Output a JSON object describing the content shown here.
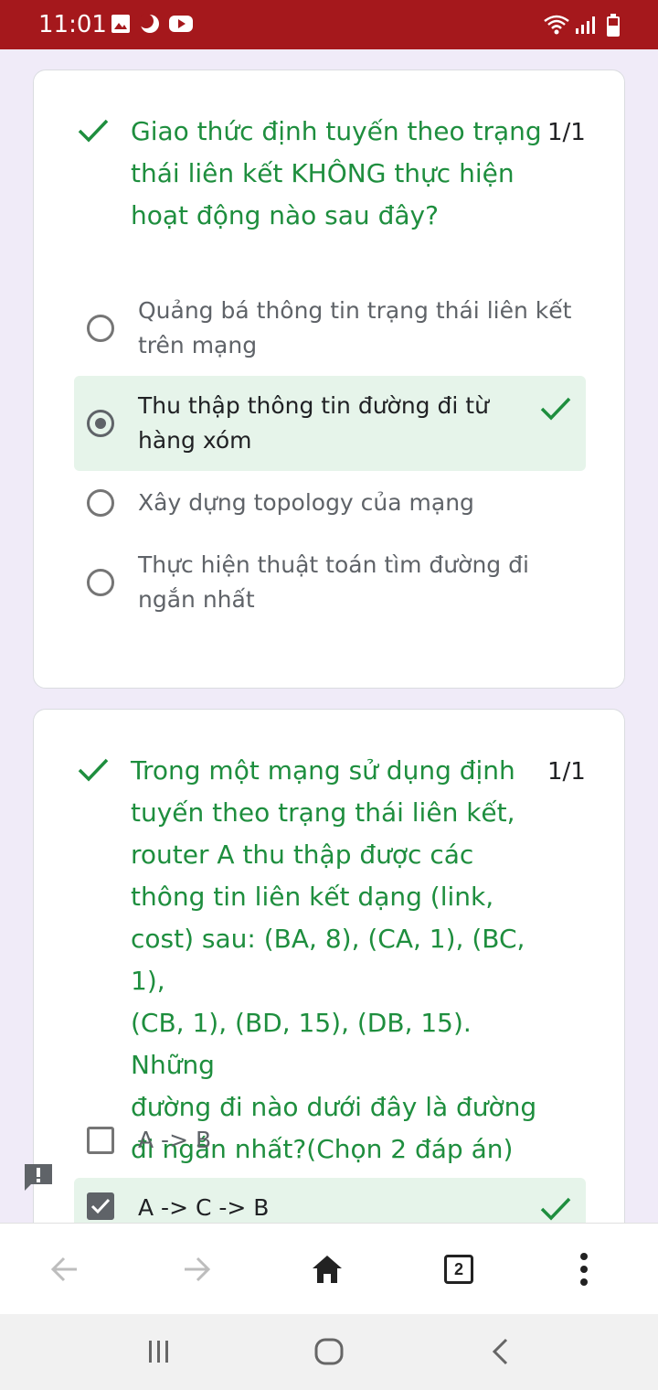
{
  "status_bar": {
    "time": "11:01",
    "icons": [
      "image-icon",
      "moon-icon",
      "youtube-icon",
      "wifi-icon",
      "signal-icon",
      "battery-icon"
    ]
  },
  "questions": [
    {
      "text_lines": [
        "Giao thức định tuyến theo trạng",
        "thái liên kết KHÔNG thực hiện",
        "hoạt động nào sau đây?"
      ],
      "score": "1/1",
      "options": [
        {
          "lines": [
            "Quảng bá thông tin trạng thái liên kết",
            "trên mạng"
          ],
          "selected": false,
          "correct": false
        },
        {
          "lines": [
            "Thu thập thông tin đường đi từ",
            "hàng xóm"
          ],
          "selected": true,
          "correct": true
        },
        {
          "lines": [
            "Xây dựng topology của mạng"
          ],
          "selected": false,
          "correct": false
        },
        {
          "lines": [
            "Thực hiện thuật toán tìm đường đi",
            "ngắn nhất"
          ],
          "selected": false,
          "correct": false
        }
      ]
    },
    {
      "text_lines": [
        "Trong một mạng sử dụng định",
        "tuyến theo trạng thái liên kết,",
        "router A thu thập được các",
        "thông tin liên kết dạng (link,",
        "cost) sau: (BA, 8), (CA, 1), (BC, 1),",
        "(CB, 1), (BD, 15), (DB, 15). Những",
        "đường đi nào dưới đây là đường",
        "đi ngắn nhất?(Chọn 2 đáp án)"
      ],
      "score": "1/1",
      "options": [
        {
          "lines": [
            "A -> B"
          ],
          "selected": false,
          "correct": false
        },
        {
          "lines": [
            "A -> C -> B"
          ],
          "selected": true,
          "correct": true
        }
      ]
    }
  ],
  "browser_nav": {
    "tab_count": "2"
  },
  "colors": {
    "status_bar": "#a5181c",
    "correct_green": "#1e8e3e",
    "correct_bg": "#e6f4ea",
    "page_bg": "#f0ebf8"
  }
}
